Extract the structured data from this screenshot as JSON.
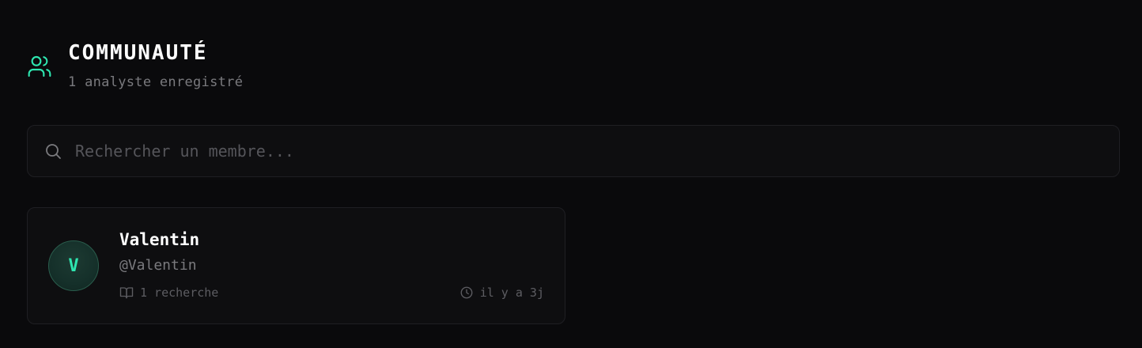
{
  "header": {
    "title": "COMMUNAUTÉ",
    "subtitle": "1 analyste enregistré",
    "icon": "users-icon",
    "accent_color": "#2ee6b0"
  },
  "search": {
    "placeholder": "Rechercher un membre...",
    "value": "",
    "icon": "search-icon"
  },
  "members": [
    {
      "initial": "V",
      "name": "Valentin",
      "handle": "@Valentin",
      "research_count": "1 recherche",
      "research_icon": "book-icon",
      "last_active": "il y a 3j",
      "time_icon": "clock-icon"
    }
  ]
}
